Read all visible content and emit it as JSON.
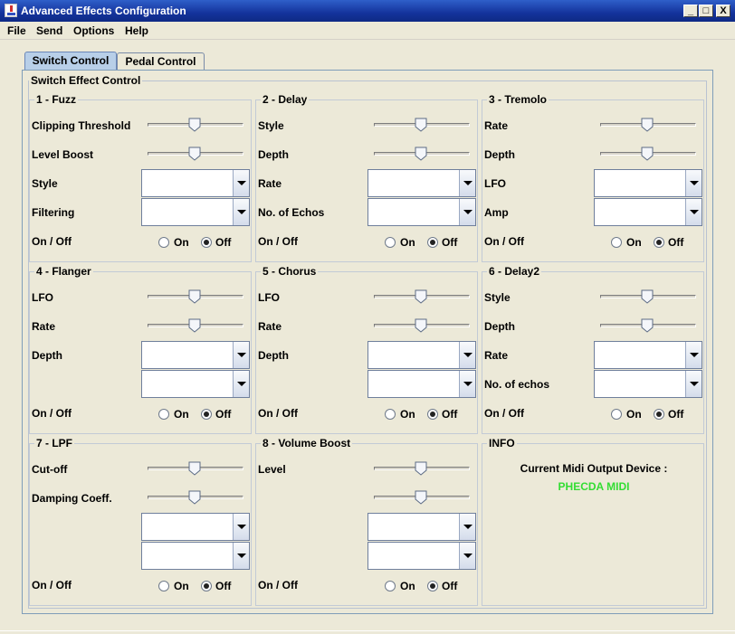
{
  "window": {
    "title": "Advanced Effects Configuration",
    "minimize": "_",
    "maximize": "□",
    "close": "X"
  },
  "menu": [
    "File",
    "Send",
    "Options",
    "Help"
  ],
  "tabs": [
    {
      "label": "Switch Control",
      "selected": true
    },
    {
      "label": "Pedal Control",
      "selected": false
    }
  ],
  "panel_title": "Switch Effect Control",
  "groups": [
    {
      "title": "1 - Fuzz",
      "sliders": [
        {
          "label": "Clipping Threshold"
        },
        {
          "label": "Level Boost"
        }
      ],
      "combos": [
        {
          "label": "Style",
          "value": ""
        },
        {
          "label": "Filtering",
          "value": ""
        }
      ],
      "onoff": {
        "label": "On / Off",
        "on": "On",
        "off": "Off",
        "selected": "off"
      }
    },
    {
      "title": "2 - Delay",
      "sliders": [
        {
          "label": "Style"
        },
        {
          "label": "Depth"
        }
      ],
      "combos": [
        {
          "label": "Rate",
          "value": ""
        },
        {
          "label": "No. of Echos",
          "value": ""
        }
      ],
      "onoff": {
        "label": "On / Off",
        "on": "On",
        "off": "Off",
        "selected": "off"
      }
    },
    {
      "title": "3 - Tremolo",
      "sliders": [
        {
          "label": "Rate"
        },
        {
          "label": "Depth"
        }
      ],
      "combos": [
        {
          "label": "LFO",
          "value": ""
        },
        {
          "label": "Amp",
          "value": ""
        }
      ],
      "onoff": {
        "label": "On / Off",
        "on": "On",
        "off": "Off",
        "selected": "off"
      }
    },
    {
      "title": "4 - Flanger",
      "sliders": [
        {
          "label": "LFO"
        },
        {
          "label": "Rate"
        }
      ],
      "combos": [
        {
          "label": "Depth",
          "value": ""
        },
        {
          "label": "",
          "value": ""
        }
      ],
      "onoff": {
        "label": "On / Off",
        "on": "On",
        "off": "Off",
        "selected": "off"
      }
    },
    {
      "title": "5 - Chorus",
      "sliders": [
        {
          "label": "LFO"
        },
        {
          "label": "Rate"
        }
      ],
      "combos": [
        {
          "label": "Depth",
          "value": ""
        },
        {
          "label": "",
          "value": ""
        }
      ],
      "onoff": {
        "label": "On / Off",
        "on": "On",
        "off": "Off",
        "selected": "off"
      }
    },
    {
      "title": "6 - Delay2",
      "sliders": [
        {
          "label": "Style"
        },
        {
          "label": "Depth"
        }
      ],
      "combos": [
        {
          "label": "Rate",
          "value": ""
        },
        {
          "label": "No. of echos",
          "value": ""
        }
      ],
      "onoff": {
        "label": "On / Off",
        "on": "On",
        "off": "Off",
        "selected": "off"
      }
    },
    {
      "title": "7 - LPF",
      "sliders": [
        {
          "label": "Cut-off"
        },
        {
          "label": "Damping Coeff."
        }
      ],
      "combos": [
        {
          "label": "",
          "value": ""
        },
        {
          "label": "",
          "value": ""
        }
      ],
      "onoff": {
        "label": "On / Off",
        "on": "On",
        "off": "Off",
        "selected": "off"
      }
    },
    {
      "title": "8 - Volume Boost",
      "sliders": [
        {
          "label": "Level"
        },
        {
          "label": ""
        }
      ],
      "combos": [
        {
          "label": "",
          "value": ""
        },
        {
          "label": "",
          "value": ""
        }
      ],
      "onoff": {
        "label": "On / Off",
        "on": "On",
        "off": "Off",
        "selected": "off"
      }
    }
  ],
  "info": {
    "title": "INFO",
    "device_label": "Current Midi Output Device :",
    "device_name": "PHECDA MIDI",
    "device_color": "#33dd33"
  },
  "colors": {
    "titlebar": "#1a3fae",
    "background": "#ece9d8",
    "selected_tab": "#b8cfe8"
  }
}
